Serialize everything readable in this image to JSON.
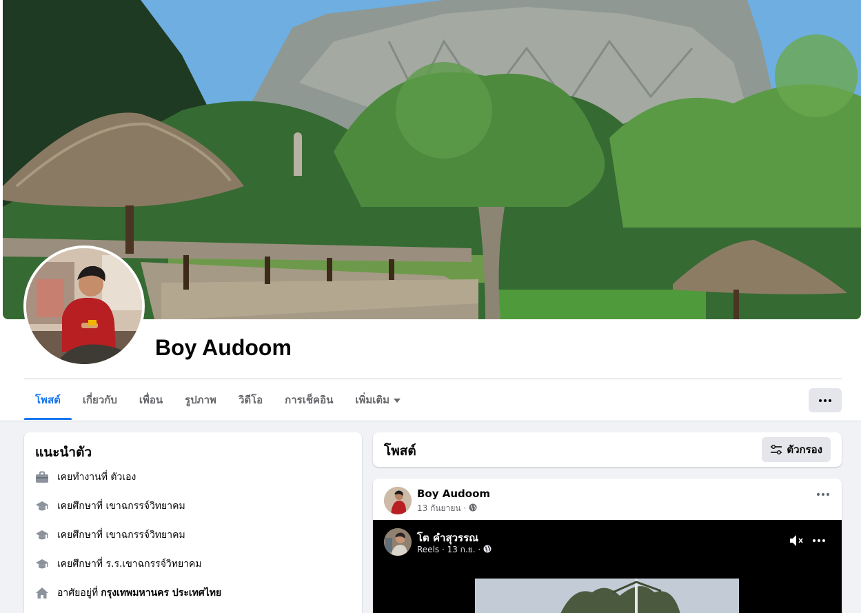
{
  "profile": {
    "name": "Boy Audoom"
  },
  "tabs": [
    {
      "label": "โพสต์",
      "active": true
    },
    {
      "label": "เกี่ยวกับ"
    },
    {
      "label": "เพื่อน"
    },
    {
      "label": "รูปภาพ"
    },
    {
      "label": "วิดีโอ"
    },
    {
      "label": "การเช็คอิน"
    },
    {
      "label": "เพิ่มเติม"
    }
  ],
  "intro": {
    "title": "แนะนำตัว",
    "items": [
      {
        "icon": "briefcase-icon",
        "text": "เคยทำงานที่ ตัวเอง",
        "bold": ""
      },
      {
        "icon": "graduation-cap-icon",
        "text": "เคยศึกษาที่ เขาฉกรรจ์วิทยาคม",
        "bold": ""
      },
      {
        "icon": "graduation-cap-icon",
        "text": "เคยศึกษาที่ เขาฉกรรจ์วิทยาคม",
        "bold": ""
      },
      {
        "icon": "graduation-cap-icon",
        "text": "เคยศึกษาที่ ร.ร.เขาฉกรรจ์วิทยาคม",
        "bold": ""
      },
      {
        "icon": "home-icon",
        "text": "อาศัยอยู่ที่",
        "bold": "กรุงเทพมหานคร ประเทศไทย"
      }
    ]
  },
  "posts": {
    "title": "โพสต์",
    "filter_label": "ตัวกรอง"
  },
  "post": {
    "author": "Boy Audoom",
    "date": "13 กันยายน ·",
    "reel": {
      "author": "โต คำสุวรรณ",
      "meta": "Reels · 13 ก.ย. ·"
    }
  },
  "colors": {
    "accent": "#1877f2",
    "background": "#f0f2f5",
    "button_gray": "#e4e6eb"
  }
}
